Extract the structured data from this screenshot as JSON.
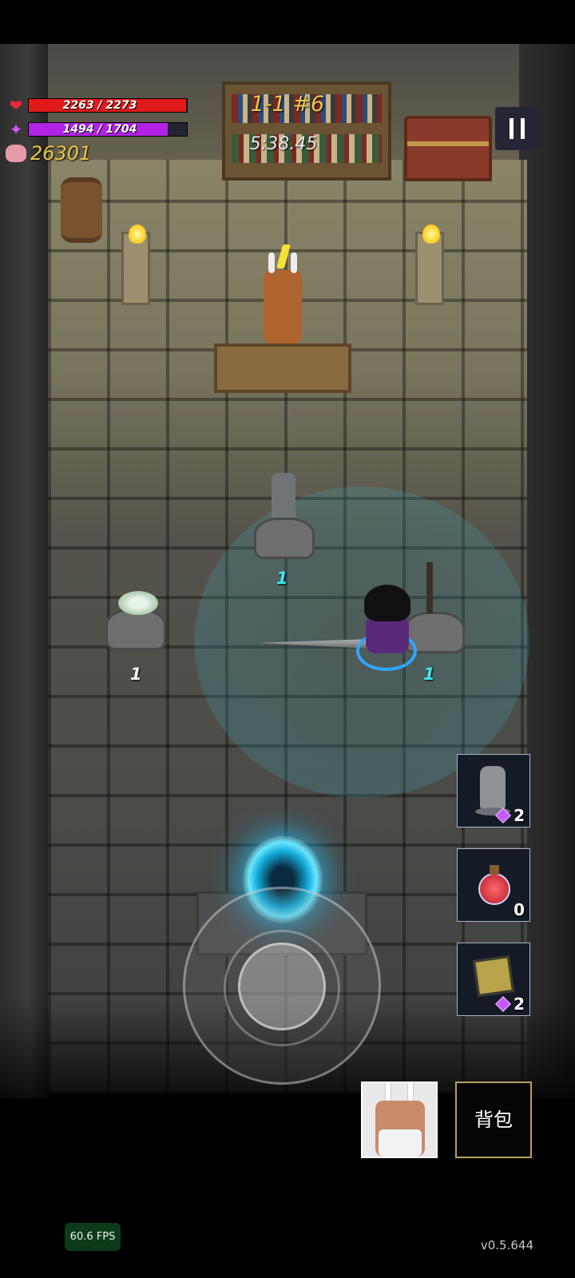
{
  "hud": {
    "hp_text": "2263 / 2273",
    "hp_fraction": 0.9956,
    "mp_text": "1494 / 1704",
    "mp_fraction": 0.8768,
    "gold": "26301",
    "stage": "1-1 #6",
    "timer": "5:38.45",
    "hp_icon": "heart-icon",
    "mp_icon": "gem-icon",
    "gold_icon": "piggy-bank-icon",
    "pause_icon": "pause-icon"
  },
  "world_labels": {
    "statue_pedestal_count": "1",
    "skull_pedestal_count": "1",
    "sword_pedestal_count": "1"
  },
  "items": [
    {
      "icon": "stone-head-statue-icon",
      "count": "2",
      "cost_icon": "gem-icon"
    },
    {
      "icon": "red-potion-icon",
      "count": "0"
    },
    {
      "icon": "golden-cube-box-icon",
      "count": "2",
      "cost_icon": "gem-icon"
    }
  ],
  "buttons": {
    "portrait_icon": "bunny-eared-merchant-portrait",
    "bag_label": "背包"
  },
  "footer": {
    "fps": "60.6 FPS",
    "version": "v0.5.644"
  },
  "colors": {
    "hp": "#e01a1a",
    "mp": "#b223e6",
    "gold_text": "#e8c84a",
    "stage_text": "#e8c84a",
    "cyan_label": "#3fe6f0",
    "portal": "#12a9d8"
  }
}
